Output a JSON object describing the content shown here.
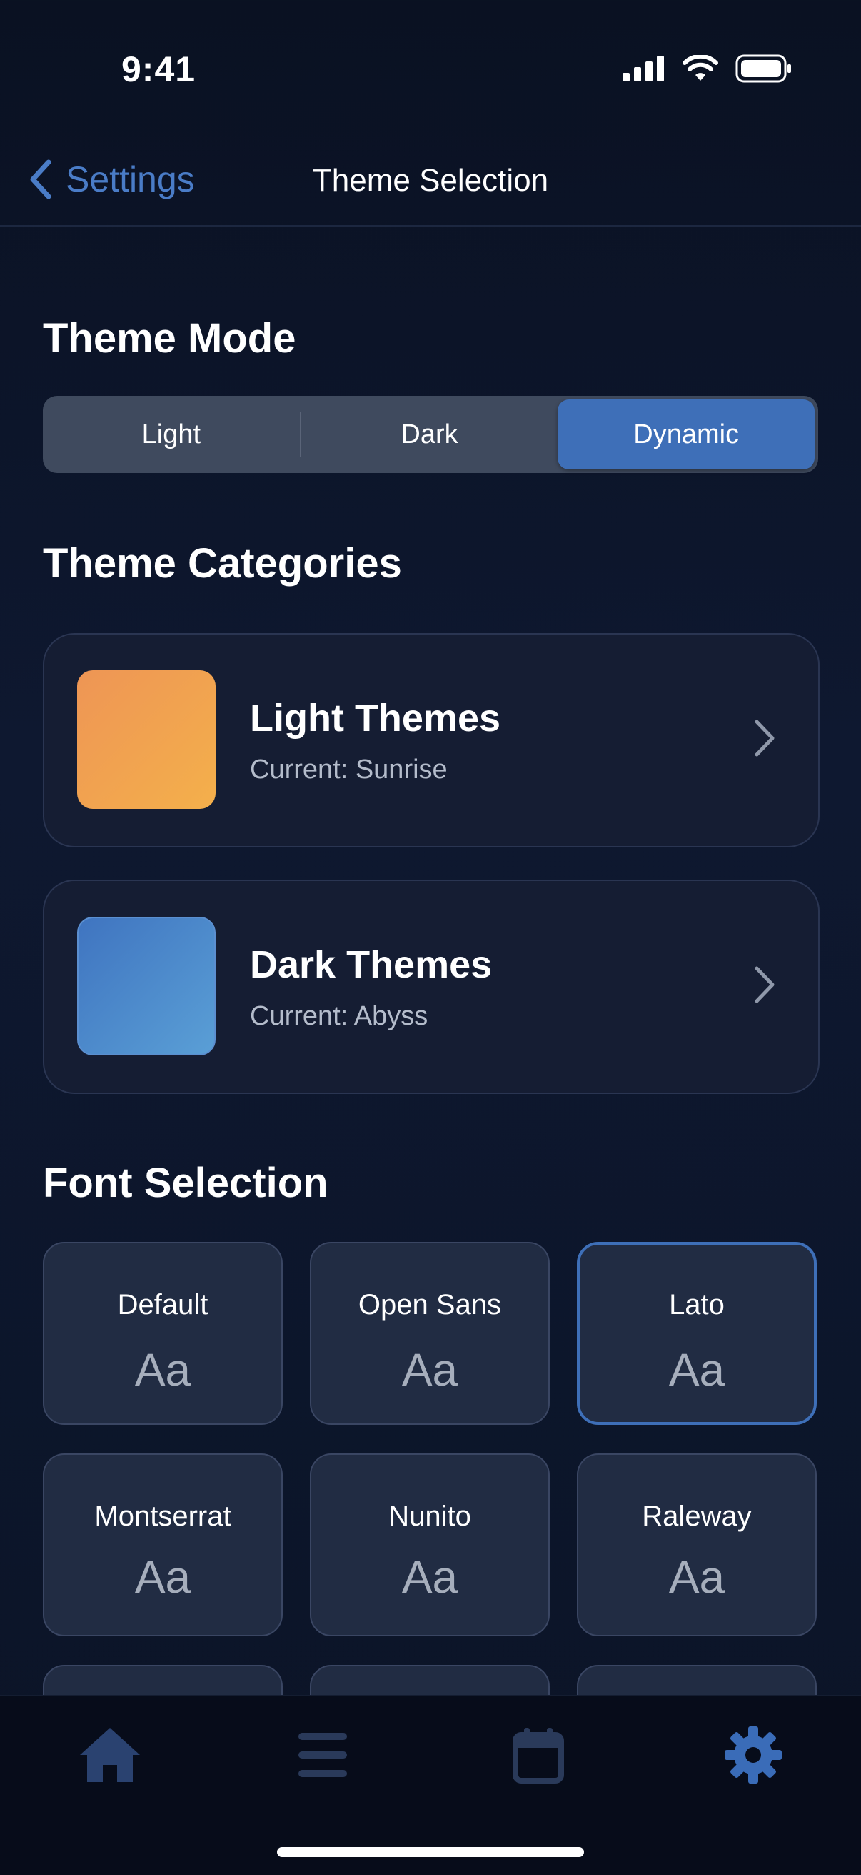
{
  "status": {
    "time": "9:41"
  },
  "nav": {
    "back_label": "Settings",
    "title": "Theme Selection"
  },
  "theme_mode": {
    "title": "Theme Mode",
    "options": [
      "Light",
      "Dark",
      "Dynamic"
    ],
    "selected": "Dynamic"
  },
  "theme_categories": {
    "title": "Theme Categories",
    "items": [
      {
        "title": "Light Themes",
        "subtitle": "Current: Sunrise"
      },
      {
        "title": "Dark Themes",
        "subtitle": "Current: Abyss"
      }
    ]
  },
  "font_selection": {
    "title": "Font Selection",
    "sample": "Aa",
    "fonts": [
      "Default",
      "Open Sans",
      "Lato",
      "Montserrat",
      "Nunito",
      "Raleway"
    ],
    "selected": "Lato"
  },
  "tabs": [
    {
      "icon": "home-icon"
    },
    {
      "icon": "menu-icon"
    },
    {
      "icon": "calendar-icon"
    },
    {
      "icon": "gear-icon",
      "active": true
    }
  ],
  "colors": {
    "accent": "#3e6fb8",
    "background": "#0e1830",
    "card": "#151d33"
  }
}
